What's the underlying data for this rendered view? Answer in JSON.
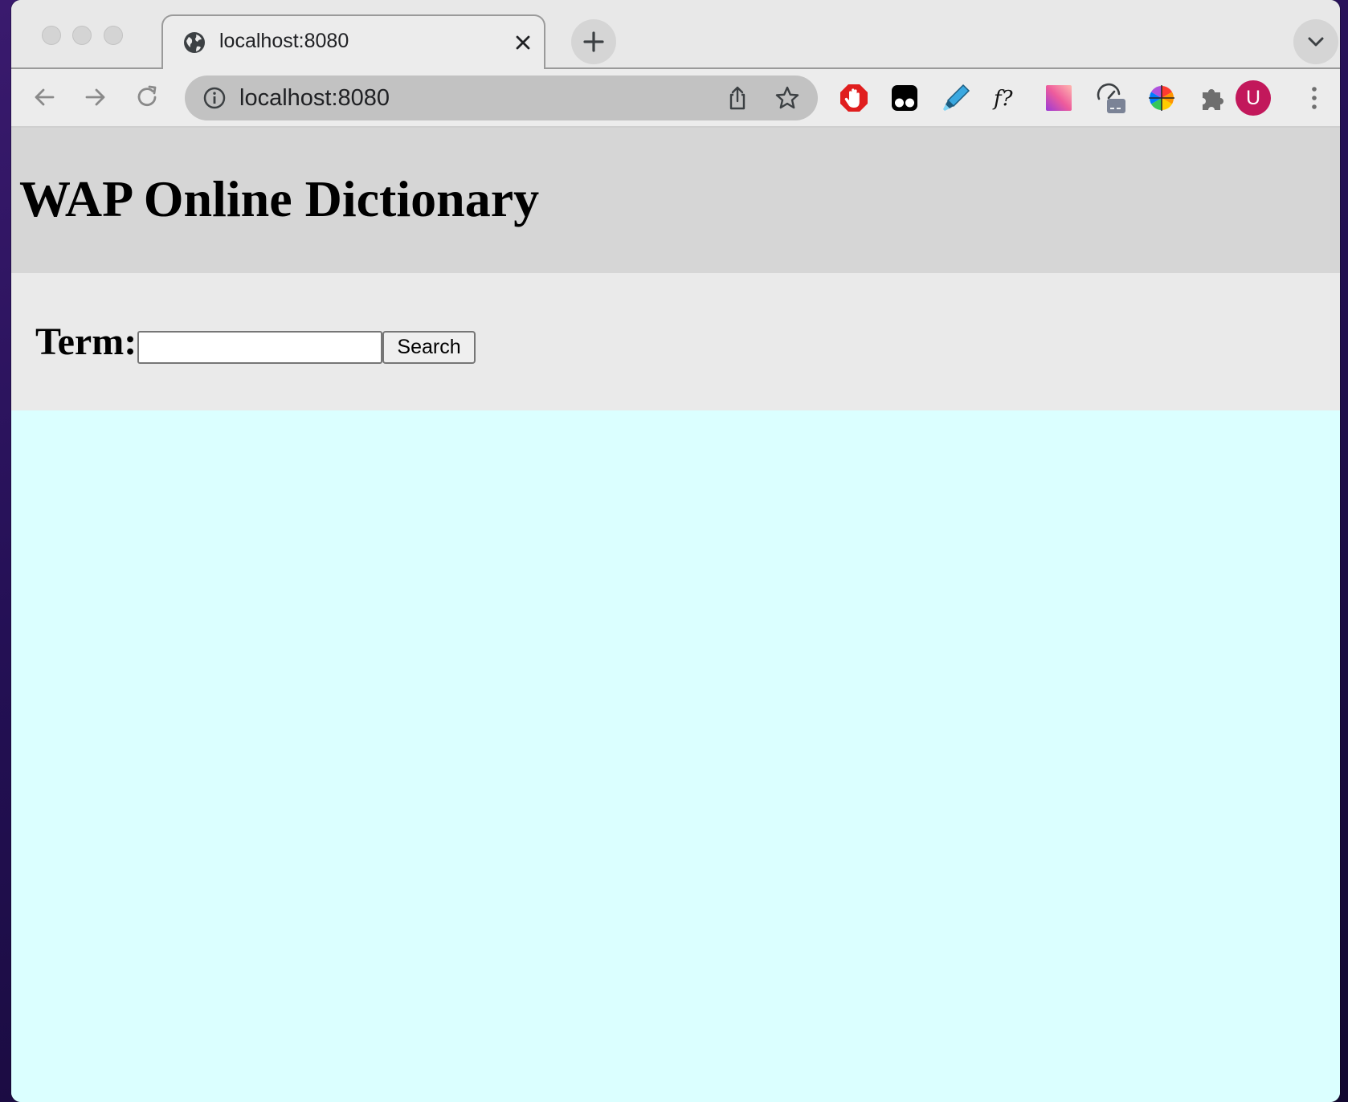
{
  "browser": {
    "tab": {
      "title": "localhost:8080"
    },
    "address_bar": {
      "url": "localhost:8080"
    },
    "profile_initial": "U",
    "extensions": [
      "adblock-icon",
      "tampermonkey-icon",
      "highlighter-icon",
      "font-finder-icon",
      "color-gradient-icon",
      "speed-test-icon",
      "color-wheel-icon",
      "extensions-puzzle-icon"
    ]
  },
  "page": {
    "title": "WAP Online Dictionary",
    "search": {
      "label": "Term:",
      "input_value": "",
      "input_placeholder": "",
      "button_label": "Search"
    }
  },
  "colors": {
    "header_band": "#d6d6d6",
    "search_band": "#eaeaea",
    "results_area": "#dbffff",
    "avatar": "#c2185b"
  }
}
